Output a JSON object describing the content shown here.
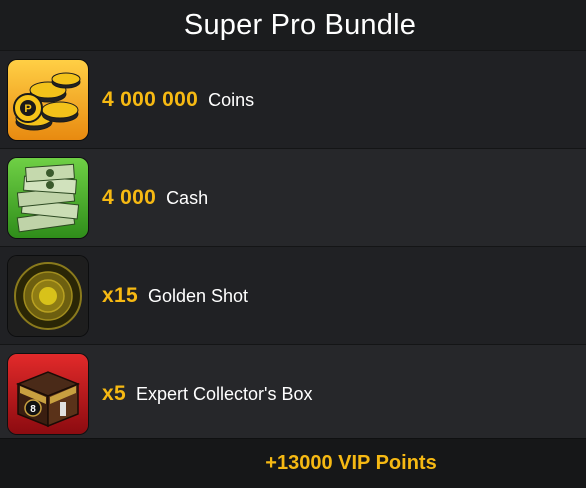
{
  "header": {
    "title": "Super Pro Bundle"
  },
  "items": [
    {
      "quantity": "4 000 000",
      "name": "Coins",
      "icon": "coins-icon",
      "tile_color": "#f0a020"
    },
    {
      "quantity": "4 000",
      "name": "Cash",
      "icon": "cash-icon",
      "tile_color": "#4cae2a"
    },
    {
      "quantity": "x15",
      "name": "Golden Shot",
      "icon": "golden-shot-icon",
      "tile_color": "#1e1e1e"
    },
    {
      "quantity": "x5",
      "name": "Expert Collector's Box",
      "icon": "collector-box-icon",
      "tile_color": "#c8141a"
    }
  ],
  "footer": {
    "vip_points": "+13000 VIP Points"
  },
  "colors": {
    "accent": "#f6b913",
    "background": "#1b1c1e"
  }
}
